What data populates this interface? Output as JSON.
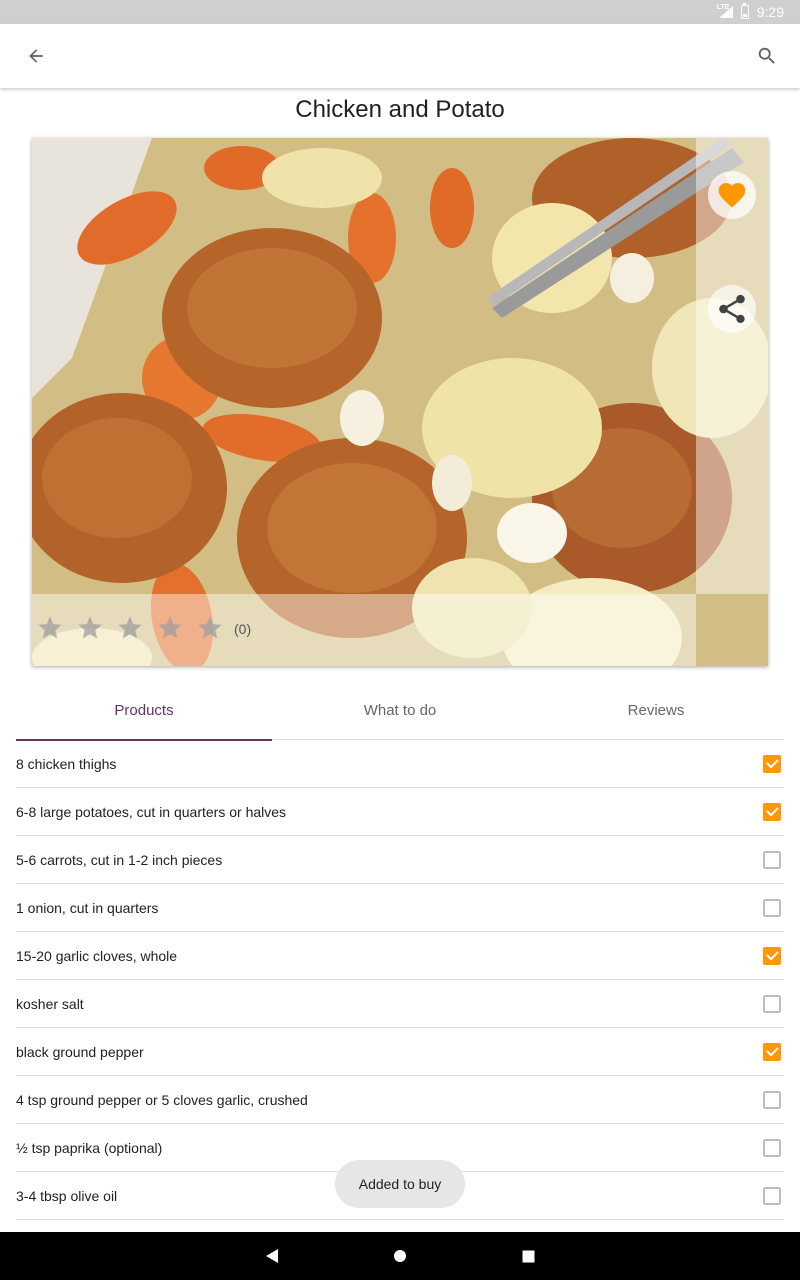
{
  "status_bar": {
    "time": "9:29",
    "network": "LTE"
  },
  "toolbar": {
    "back_icon": "arrow-back-icon",
    "search_icon": "search-icon"
  },
  "recipe": {
    "title": "Chicken and Potato",
    "favorite": true,
    "rating": {
      "stars": 0,
      "max": 5,
      "count_label": "(0)"
    }
  },
  "tabs": [
    {
      "label": "Products",
      "active": true
    },
    {
      "label": "What to do",
      "active": false
    },
    {
      "label": "Reviews",
      "active": false
    }
  ],
  "ingredients": [
    {
      "label": "8 chicken thighs",
      "checked": true
    },
    {
      "label": "6-8 large potatoes, cut in quarters or halves",
      "checked": true
    },
    {
      "label": "5-6 carrots, cut in 1-2 inch pieces",
      "checked": false
    },
    {
      "label": "1 onion, cut in quarters",
      "checked": false
    },
    {
      "label": "15-20 garlic cloves, whole",
      "checked": true
    },
    {
      "label": "kosher salt",
      "checked": false
    },
    {
      "label": "black ground pepper",
      "checked": true
    },
    {
      "label": "4 tsp ground pepper or 5 cloves garlic, crushed",
      "checked": false
    },
    {
      "label": "½ tsp paprika (optional)",
      "checked": false
    },
    {
      "label": "3-4 tbsp olive oil",
      "checked": false
    }
  ],
  "toast": {
    "message": "Added to buy"
  },
  "colors": {
    "accent": "#ff9800",
    "tab_active": "#6b2f63"
  }
}
